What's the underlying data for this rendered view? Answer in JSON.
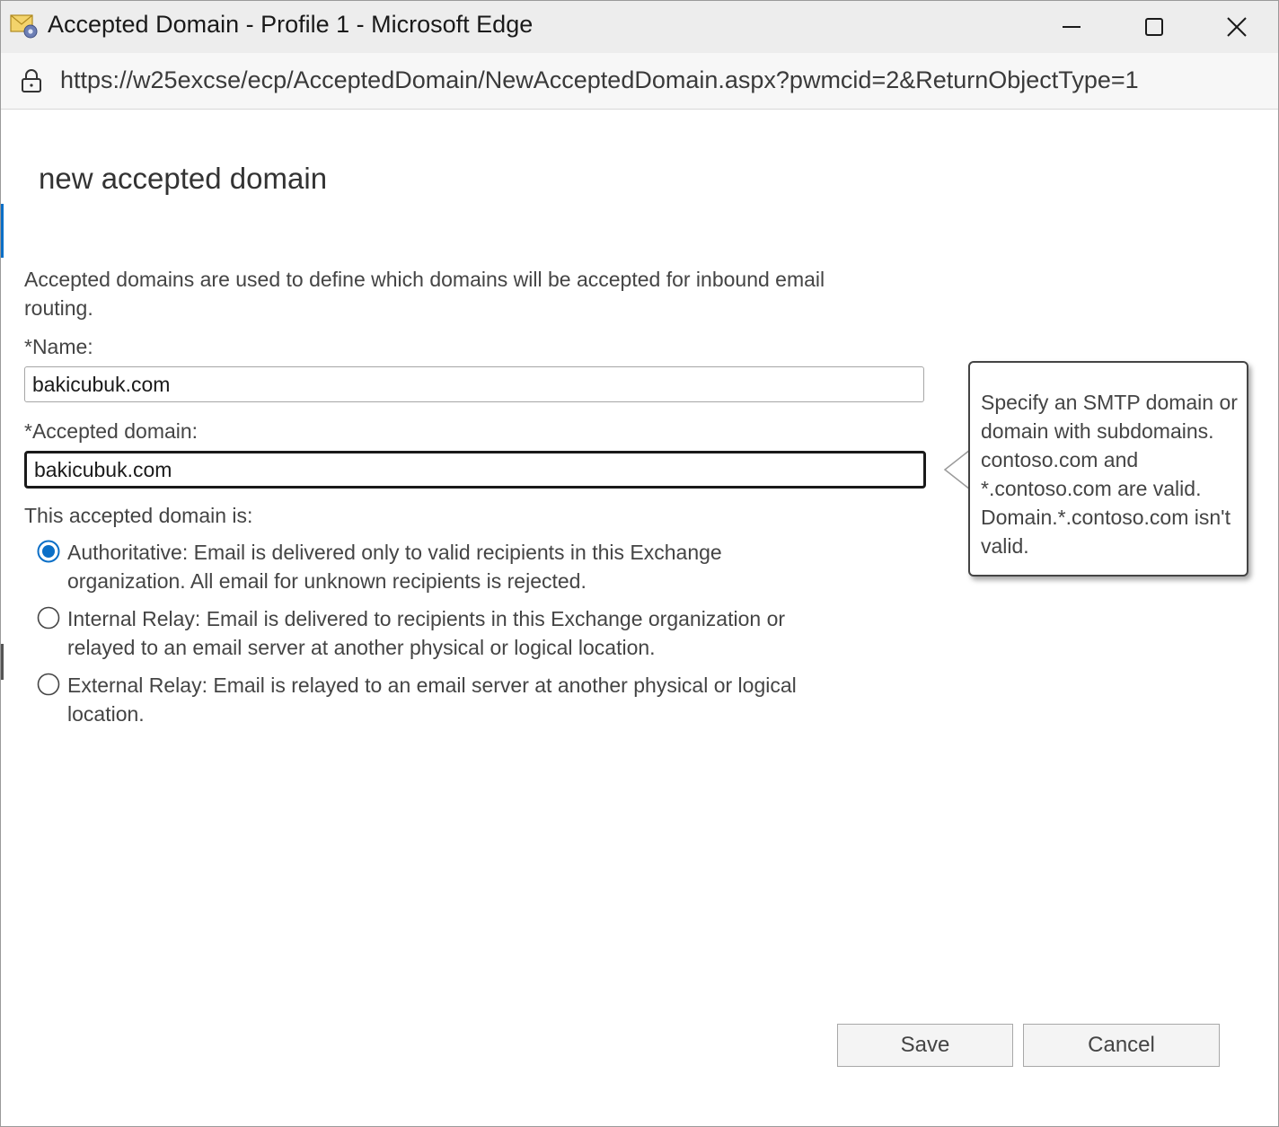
{
  "window": {
    "title": "Accepted Domain - Profile 1 - Microsoft Edge",
    "app_icon": "exchange-mail-icon",
    "controls": {
      "minimize_icon": "minimize-icon",
      "maximize_icon": "maximize-icon",
      "close_icon": "close-icon"
    }
  },
  "address_bar": {
    "lock_icon": "lock-icon",
    "url": "https://w25excse/ecp/AcceptedDomain/NewAcceptedDomain.aspx?pwmcid=2&ReturnObjectType=1"
  },
  "form": {
    "title": "new accepted domain",
    "intro": "Accepted domains are used to define which domains will be accepted for inbound email routing.",
    "name_label": "*Name:",
    "name_value": "bakicubuk.com",
    "domain_label": "*Accepted domain:",
    "domain_value": "bakicubuk.com",
    "type_label": "This accepted domain is:",
    "options": [
      {
        "label": "Authoritative: Email is delivered only to valid recipients in this Exchange organization. All email for unknown recipients is rejected.",
        "selected": true
      },
      {
        "label": "Internal Relay: Email is delivered to recipients in this Exchange organization or relayed to an email server at another physical or logical location.",
        "selected": false
      },
      {
        "label": "External Relay: Email is relayed to an email server at another physical or logical location.",
        "selected": false
      }
    ]
  },
  "tooltip": {
    "text": "Specify an SMTP domain or domain with subdomains. contoso.com and *.contoso.com are valid. Domain.*.contoso.com isn't valid."
  },
  "buttons": {
    "save": "Save",
    "cancel": "Cancel"
  },
  "colors": {
    "accent": "#0b6fc7",
    "titlebar_bg": "#ededed",
    "text": "#444444"
  }
}
